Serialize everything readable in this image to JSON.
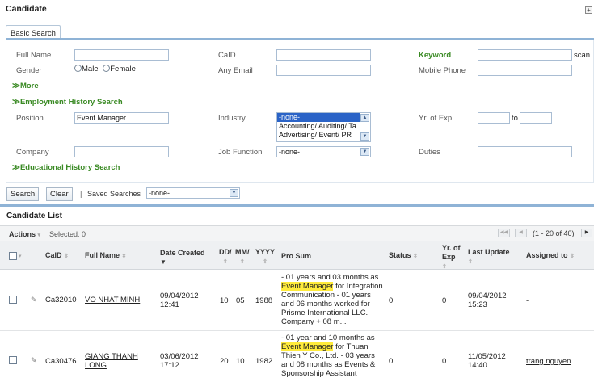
{
  "candidate_section": {
    "title": "Candidate",
    "expand_symbol": "+"
  },
  "tabs": [
    {
      "label": "Basic Search"
    }
  ],
  "form": {
    "full_name_label": "Full Name",
    "full_name_value": "",
    "caid_label": "CaID",
    "caid_value": "",
    "keyword_label": "Keyword",
    "keyword_value": "",
    "scan_label": "scan",
    "gender_label": "Gender",
    "male_label": "Male",
    "female_label": "Female",
    "any_email_label": "Any Email",
    "mobile_phone_label": "Mobile Phone",
    "more_label": "More",
    "employment_history_label": "Employment History Search",
    "position_label": "Position",
    "position_value": "Event Manager",
    "industry_label": "Industry",
    "industry_options": [
      "-none-",
      "Accounting/ Auditing/ Ta",
      "Advertising/ Event/ PR"
    ],
    "industry_selected_index": 0,
    "yr_exp_label": "Yr. of Exp",
    "yr_exp_to_label": "to",
    "company_label": "Company",
    "job_function_label": "Job Function",
    "job_function_value": "-none-",
    "duties_label": "Duties",
    "educational_history_label": "Educational History Search",
    "collapse_glyph": "≫"
  },
  "actions": {
    "search_label": "Search",
    "clear_label": "Clear",
    "separator": "|",
    "saved_searches_label": "Saved Searches",
    "saved_searches_value": "-none-"
  },
  "list": {
    "title": "Candidate List",
    "actions_label": "Actions",
    "selected_label": "Selected: 0",
    "pagination": "(1 - 20 of 40)",
    "columns": {
      "caid": "CaID",
      "full_name": "Full Name",
      "date_created": "Date Created",
      "dd": "DD/",
      "mm": "MM/",
      "yyyy": "YYYY",
      "pro_sum": "Pro Sum",
      "status": "Status",
      "yr_of_exp_1": "Yr. of",
      "yr_of_exp_2": "Exp",
      "last_update": "Last Update",
      "assigned_to": "Assigned to"
    },
    "rows": [
      {
        "caid": "Ca32010",
        "name_1": "VO NHAT MINH",
        "name_2": "",
        "date_1": "09/04/2012",
        "date_2": "12:41",
        "dd": "10",
        "mm": "05",
        "yyyy": "1988",
        "prosum_1": "- 01 years and 03 months as",
        "prosum_hl": "Event Manager",
        "prosum_hl_rest": " for Integration",
        "prosum_3": "Communication - 01 years",
        "prosum_4": "and 06 months worked for",
        "prosum_5": "Prisme International LLC.",
        "prosum_6": "Company + 08 m...",
        "status": "0",
        "yr_exp": "0",
        "last_1": "09/04/2012",
        "last_2": "15:23",
        "assigned": "-"
      },
      {
        "caid": "Ca30476",
        "name_1": "GIANG THANH",
        "name_2": "LONG",
        "date_1": "03/06/2012",
        "date_2": "17:12",
        "dd": "20",
        "mm": "10",
        "yyyy": "1982",
        "prosum_1": "- 01 year and 10 months as",
        "prosum_hl": "Event Manager",
        "prosum_hl_rest": " for Thuan",
        "prosum_3": "Thien Y Co., Ltd. - 03 years",
        "prosum_4": "and 08 months as Events &",
        "prosum_5": "Sponsorship Assistant",
        "prosum_6": "",
        "status": "0",
        "yr_exp": "0",
        "last_1": "11/05/2012",
        "last_2": "14:40",
        "assigned": "trang.nguyen"
      }
    ]
  }
}
